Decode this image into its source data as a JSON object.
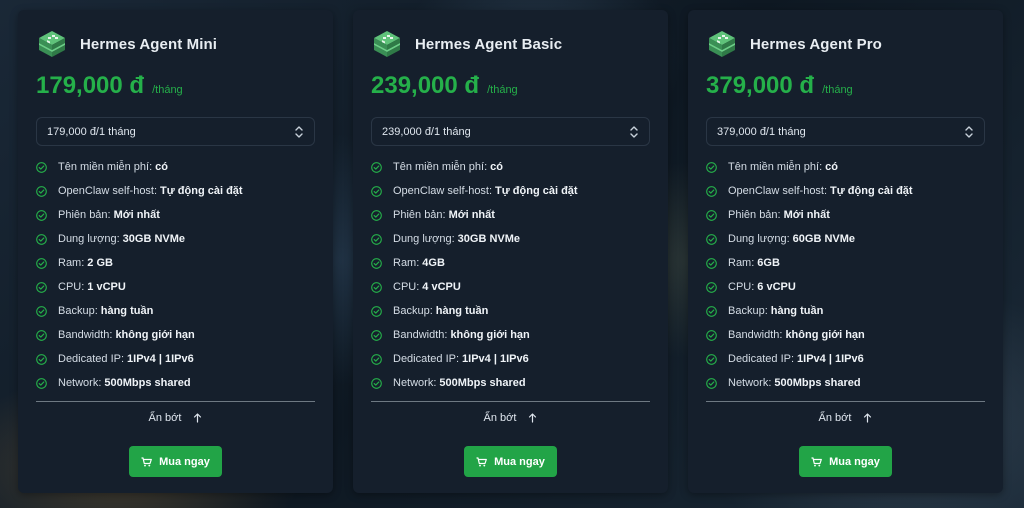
{
  "theme": {
    "accent": "#25b04a",
    "button": "#22a447",
    "card_bg": "#151f2c"
  },
  "plans": [
    {
      "name": "Hermes Agent Mini",
      "price": "179,000 đ",
      "period": "/tháng",
      "billing_selected": "179,000 đ/1 tháng",
      "features": [
        {
          "label": "Tên miền miễn phí:",
          "value": "có"
        },
        {
          "label": "OpenClaw self-host:",
          "value": "Tự động cài đặt"
        },
        {
          "label": "Phiên bản:",
          "value": "Mới nhất"
        },
        {
          "label": "Dung lượng:",
          "value": "30GB NVMe"
        },
        {
          "label": "Ram:",
          "value": "2 GB"
        },
        {
          "label": "CPU:",
          "value": "1 vCPU"
        },
        {
          "label": "Backup:",
          "value": "hàng tuần"
        },
        {
          "label": "Bandwidth:",
          "value": "không giới hạn"
        },
        {
          "label": "Dedicated IP:",
          "value": "1IPv4 | 1IPv6"
        },
        {
          "label": "Network:",
          "value": "500Mbps shared"
        }
      ],
      "collapse_label": "Ẩn bớt",
      "buy_label": "Mua ngay"
    },
    {
      "name": "Hermes Agent Basic",
      "price": "239,000 đ",
      "period": "/tháng",
      "billing_selected": "239,000 đ/1 tháng",
      "features": [
        {
          "label": "Tên miền miễn phí:",
          "value": "có"
        },
        {
          "label": "OpenClaw self-host:",
          "value": "Tự động cài đặt"
        },
        {
          "label": "Phiên bản:",
          "value": "Mới nhất"
        },
        {
          "label": "Dung lượng:",
          "value": "30GB NVMe"
        },
        {
          "label": "Ram:",
          "value": "4GB"
        },
        {
          "label": "CPU:",
          "value": "4 vCPU"
        },
        {
          "label": "Backup:",
          "value": "hàng tuần"
        },
        {
          "label": "Bandwidth:",
          "value": "không giới hạn"
        },
        {
          "label": "Dedicated IP:",
          "value": "1IPv4 | 1IPv6"
        },
        {
          "label": "Network:",
          "value": "500Mbps shared"
        }
      ],
      "collapse_label": "Ẩn bớt",
      "buy_label": "Mua ngay"
    },
    {
      "name": "Hermes Agent Pro",
      "price": "379,000 đ",
      "period": "/tháng",
      "billing_selected": "379,000 đ/1 tháng",
      "features": [
        {
          "label": "Tên miền miễn phí:",
          "value": "có"
        },
        {
          "label": "OpenClaw self-host:",
          "value": "Tự động cài đặt"
        },
        {
          "label": "Phiên bản:",
          "value": "Mới nhất"
        },
        {
          "label": "Dung lượng:",
          "value": "60GB NVMe"
        },
        {
          "label": "Ram:",
          "value": "6GB"
        },
        {
          "label": "CPU:",
          "value": "6 vCPU"
        },
        {
          "label": "Backup:",
          "value": "hàng tuần"
        },
        {
          "label": "Bandwidth:",
          "value": "không giới hạn"
        },
        {
          "label": "Dedicated IP:",
          "value": "1IPv4 | 1IPv6"
        },
        {
          "label": "Network:",
          "value": "500Mbps shared"
        }
      ],
      "collapse_label": "Ẩn bớt",
      "buy_label": "Mua ngay"
    }
  ],
  "icons": {
    "logo": "server-box-icon",
    "select": "chevron-up-down-icon",
    "feature": "check-circle-icon",
    "collapse": "arrow-up-icon",
    "buy": "cart-icon"
  }
}
